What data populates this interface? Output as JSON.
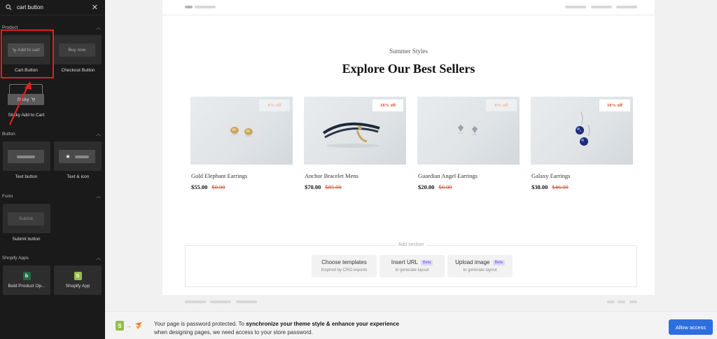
{
  "sidebar": {
    "search": {
      "value": "cart button"
    },
    "sections": [
      {
        "label": "Product"
      },
      {
        "label": "Button"
      },
      {
        "label": "Form"
      },
      {
        "label": "Shopify Apps"
      }
    ],
    "product_items": [
      {
        "pill": "Add to cart",
        "label": "Cart Button"
      },
      {
        "pill": "Buy now",
        "label": "Checkout Button"
      },
      {
        "pill": "Sticky",
        "label": "Sticky Add to Cart"
      }
    ],
    "button_items": [
      {
        "label": "Text button"
      },
      {
        "label": "Text & icon"
      }
    ],
    "form_items": [
      {
        "pill": "Submit",
        "label": "Submit button"
      }
    ],
    "app_items": [
      {
        "icon": "b",
        "label": "Bold Product Op..."
      },
      {
        "icon": "S",
        "label": "Shopify App"
      }
    ]
  },
  "section": {
    "subtitle": "Summer Styles",
    "title": "Explore Our Best Sellers"
  },
  "products": [
    {
      "name": "Gold Elephant Earrings",
      "price": "$55.00",
      "compare": "$0.00",
      "badge": "0% off"
    },
    {
      "name": "Anchor Bracelet Mens",
      "price": "$70.00",
      "compare": "$85.00",
      "badge": "18% off"
    },
    {
      "name": "Guardian Angel Earrings",
      "price": "$20.00",
      "compare": "$0.00",
      "badge": "0% off"
    },
    {
      "name": "Galaxy Earrings",
      "price": "$38.00",
      "compare": "$46.00",
      "badge": "18% off"
    }
  ],
  "add_section": {
    "title": "Add section",
    "options": [
      {
        "title": "Choose templates",
        "subtitle": "Inspired by CRO experts",
        "beta": ""
      },
      {
        "title": "Insert URL",
        "subtitle": "to generate layout",
        "beta": "Beta"
      },
      {
        "title": "Upload image",
        "subtitle": "to generate layout",
        "beta": "Beta"
      }
    ]
  },
  "banner": {
    "text_prefix": "Your page is password protected. To ",
    "text_bold": "synchronize your theme style & enhance your experience",
    "text_line2": "when designing pages, we need access to your store password.",
    "button": "Allow access"
  },
  "colors": {
    "sidebar_bg": "#1a1a1a",
    "highlight": "#e02020",
    "sale_red": "#e0493a",
    "primary_blue": "#2e6fe0",
    "beta_purple": "#5a46e0"
  }
}
